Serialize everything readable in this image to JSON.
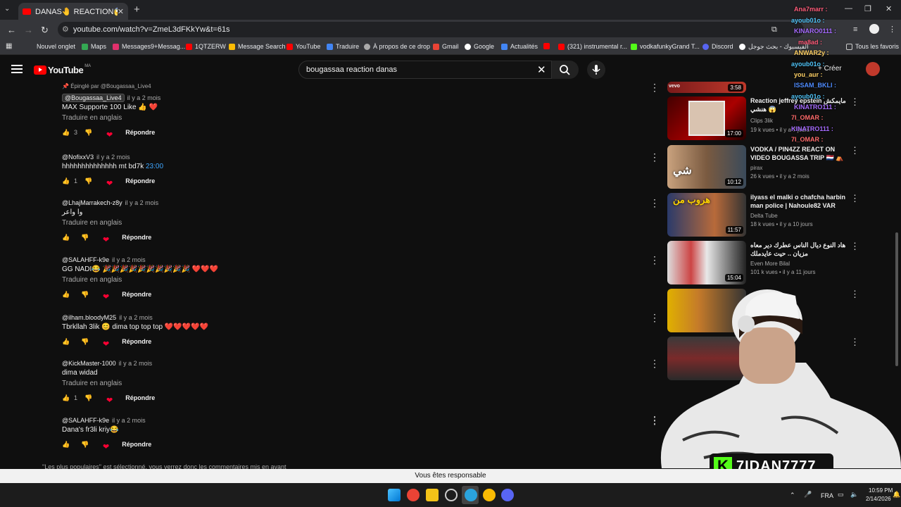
{
  "browser": {
    "tab_title": "DANAS🤚 REACTION😱VIDEO",
    "url": "youtube.com/watch?v=ZmeL3dFKkYw&t=61s",
    "bookmarks": [
      "Nouvel onglet",
      "Maps",
      "Messages9+Messag...",
      "1QTZERW",
      "Message Search",
      "YouTube",
      "Traduire",
      "À propos de ce drop",
      "Gmail",
      "Google",
      "Actualités",
      "(321) instrumental r...",
      "vodkafunkyGrand T...",
      "Discord",
      "الفيسبوك - بحث جوجل",
      "Tous les favoris"
    ]
  },
  "youtube": {
    "logo": "YouTube",
    "country": "MA",
    "search_value": "bougassaa reaction danas",
    "create_label": "Créer"
  },
  "comments": {
    "pinned_label": "Épinglé par @Bougassaa_Live4",
    "reply_label": "Répondre",
    "translate_label": "Traduire en anglais",
    "items": [
      {
        "author": "@Bougassaa_Live4",
        "time": "il y a 2 mois",
        "text": "MAX Supporte 100 Like 👍 ❤️",
        "translate": true,
        "likes": "3"
      },
      {
        "author": "@NofixxV3",
        "time": "il y a 2 mois",
        "text": "hhhhhhhhhhhhhh mt bd7k ",
        "timestamp": "23:00",
        "translate": false,
        "likes": "1"
      },
      {
        "author": "@LhajMarrakech-z8y",
        "time": "il y a 2 mois",
        "text": "وا واعر",
        "translate": true,
        "likes": ""
      },
      {
        "author": "@SALAHFF-k9e",
        "time": "il y a 2 mois",
        "text": "GG NADI😂 🎉🎉🎉🎉🎉🎉🎉🎉🎉🎉 ❤️❤️❤️",
        "translate": true,
        "likes": ""
      },
      {
        "author": "@ilham.bloodyM25",
        "time": "il y a 2 mois",
        "text": "Tbrkllah 3lik 😊 dima top top top ❤️❤️❤️❤️❤️",
        "translate": false,
        "likes": ""
      },
      {
        "author": "@KickMaster-1000",
        "time": "il y a 2 mois",
        "text": "dima widad",
        "translate": true,
        "likes": "1"
      },
      {
        "author": "@SALAHFF-k9e",
        "time": "il y a 2 mois",
        "text": "Dana's fr3li kriy😂",
        "translate": false,
        "likes": ""
      }
    ],
    "sort_note": "\"Les plus populaires\" est sélectionné, vous verrez donc les commentaires mis en avant"
  },
  "related": [
    {
      "title": "",
      "channel": "",
      "meta": "",
      "duration": "3:58"
    },
    {
      "title": "Reaction jeffrey epstein مايمكش هنشي 😱",
      "channel": "Clips 3lik",
      "meta": "19 k vues • il y a 7 jours",
      "duration": "17:00"
    },
    {
      "title": "VODKA / PIN4ZZ REACT ON VIDEO BOUGASSA TRIP 🇳🇱 ⛺",
      "channel": "pirax",
      "meta": "26 k vues • il y a 2 mois",
      "duration": "10:12"
    },
    {
      "title": "ilyass el malki o chafcha harbin man police | Nahoule82 VAR",
      "channel": "Delta Tube",
      "meta": "18 k vues • il y a 10 jours",
      "duration": "11:57"
    },
    {
      "title": "هاد النوع ديال الناس عطرك دير معاه مزيان .. حيت عايدملك",
      "channel": "Even More Bilal",
      "meta": "101 k vues • il y a 11 jours",
      "duration": "15:04"
    }
  ],
  "chat": [
    {
      "user": "Ana7marr :",
      "color": "#ff5c7a"
    },
    {
      "user": "ayoub01o :",
      "color": "#4fc3f7"
    },
    {
      "user": "KINARO0111 :",
      "color": "#a66bff"
    },
    {
      "user": "ma8ad :",
      "color": "#ff5c7a"
    },
    {
      "user": "ANWAR2y :",
      "color": "#ffd166"
    },
    {
      "user": "ayoub01o :",
      "color": "#4fc3f7"
    },
    {
      "user": "you_aur :",
      "color": "#ffd166"
    },
    {
      "user": "ISSAM_BKLI :",
      "color": "#4f8cff"
    },
    {
      "user": "ayoub01o :",
      "color": "#4fc3f7"
    },
    {
      "user": "KINATRO111 :",
      "color": "#a66bff"
    },
    {
      "user": "7I_OMAR :",
      "color": "#ff6b6b"
    },
    {
      "user": "KINATRO111 :",
      "color": "#a66bff"
    },
    {
      "user": "7I_OMAR :",
      "color": "#ff6b6b"
    }
  ],
  "stream": {
    "name": "7IDAN7777"
  },
  "banner": "Vous êtes responsable",
  "taskbar": {
    "lang": "FRA",
    "time": "10:59 PM",
    "date": "2/14/2026"
  }
}
